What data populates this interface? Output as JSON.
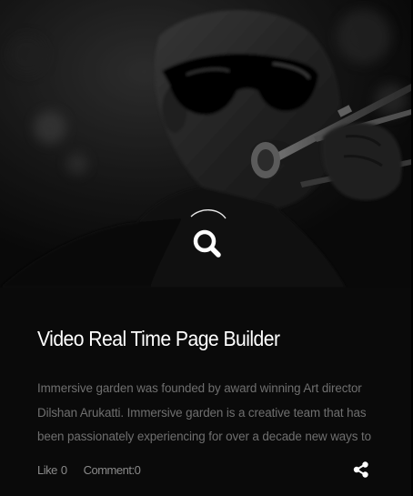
{
  "post": {
    "title": "Video Real Time Page Builder",
    "excerpt": "Immersive garden was founded by award winning Art director Dilshan Arukatti. Immersive garden is a creative team that has been passionately experiencing for over a decade new ways to",
    "meta": {
      "like_label": "Like",
      "like_count": "0",
      "comment_label": "Comment:",
      "comment_count": "0"
    },
    "image_alt": "musician playing trombone"
  },
  "icons": {
    "zoom": "search-icon",
    "share": "share-icon"
  },
  "colors": {
    "card_background": "#0a0a0a",
    "title": "#ffffff",
    "text": "#6f6f6f",
    "meta": "#8a8a8a"
  }
}
